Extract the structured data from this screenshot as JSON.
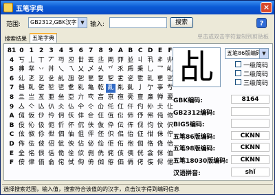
{
  "window": {
    "title": "五笔字典",
    "close_glyph": "×"
  },
  "toolbar": {
    "range_label": "范围:",
    "range_value": "GB2312,GBK汉字",
    "input_label": "输入:",
    "input_value": "",
    "search_label": "搜索",
    "help_label": "?",
    "hint": "单击或双击字符复制到剪贴板"
  },
  "tabs": [
    {
      "label": "搜索结果",
      "active": false
    },
    {
      "label": "五笔字典",
      "active": true
    }
  ],
  "grid": {
    "corner": "81",
    "col_headers": [
      "0",
      "1",
      "2",
      "3",
      "4",
      "5",
      "6",
      "7",
      "8",
      "9",
      "A",
      "B",
      "C",
      "D",
      "E",
      "F"
    ],
    "row_headers": [
      "4",
      "5",
      "6",
      "7",
      "8",
      "9",
      "A",
      "B",
      "C",
      "D",
      "E",
      "F"
    ],
    "rows": [
      [
        "丂",
        "丄",
        "丅",
        "丆",
        "丏",
        "丒",
        "丗",
        "丟",
        "丠",
        "両",
        "丣",
        "並",
        "丩",
        "丮",
        "丯",
        "丱"
      ],
      [
        "丳",
        "丵",
        "丷",
        "丼",
        "乀",
        "乁",
        "乂",
        "乄",
        "乆",
        "乊",
        "乑",
        "乕",
        "乗",
        "乚",
        "乛",
        "乢"
      ],
      [
        "乣",
        "乤",
        "乥",
        "乧",
        "乨",
        "乪",
        "乫",
        "乬",
        "乭",
        "乮",
        "乯",
        "乲",
        "乴",
        "乵",
        "乶",
        "乷"
      ],
      [
        "乸",
        "乹",
        "乺",
        "乻",
        "乼",
        "乽",
        "乿",
        "亀",
        "亁",
        "亂",
        "亃",
        "亄",
        "亅",
        "亇",
        "亊",
        "亐"
      ],
      [
        "亖",
        "亗",
        "亙",
        "亜",
        "亝",
        "亞",
        "亣",
        "亪",
        "亯",
        "亰",
        "亱",
        "亴",
        "亶",
        "亷",
        "亸",
        "亹"
      ],
      [
        "亼",
        "亽",
        "亾",
        "仈",
        "仌",
        "仏",
        "仐",
        "仒",
        "仚",
        "仛",
        "仜",
        "仠",
        "仢",
        "仦",
        "仧",
        "仩"
      ],
      [
        "仭",
        "仮",
        "仯",
        "仱",
        "仴",
        "仸",
        "仹",
        "仺",
        "仼",
        "仾",
        "伀",
        "伂",
        "伃",
        "伄",
        "伅",
        "伆"
      ],
      [
        "伇",
        "伈",
        "伋",
        "伌",
        "伒",
        "伓",
        "伔",
        "伕",
        "伖",
        "伜",
        "伝",
        "伡",
        "伣",
        "伨",
        "伩",
        "伬"
      ],
      [
        "伭",
        "伮",
        "伱",
        "伳",
        "伵",
        "伷",
        "伹",
        "伻",
        "伾",
        "伿",
        "佀",
        "佁",
        "佂",
        "佄",
        "佅",
        "佇"
      ],
      [
        "佈",
        "佉",
        "佊",
        "佋",
        "佌",
        "佒",
        "佔",
        "佖",
        "佡",
        "佢",
        "佦",
        "佨",
        "佪",
        "佫",
        "佭",
        "佮"
      ],
      [
        "佱",
        "佲",
        "佷",
        "佸",
        "佹",
        "佺",
        "佽",
        "侀",
        "侁",
        "侂",
        "侅",
        "侇",
        "侊",
        "侌",
        "侎",
        "侐"
      ],
      [
        "侒",
        "侓",
        "侕",
        "侖",
        "侘",
        "侙",
        "侚",
        "侜",
        "侞",
        "侟",
        "価",
        "侢",
        "侤",
        "侫",
        "侭",
        "侰"
      ]
    ],
    "selected": {
      "row": 3,
      "col": 9
    }
  },
  "detail": {
    "char": "乩",
    "scheme_value": "五笔86版编码",
    "options": [
      "一级简码",
      "二级简码",
      "三级简码"
    ],
    "info": [
      {
        "label": "GBK编码:",
        "value": "8164"
      },
      {
        "label": "GB2312编码:",
        "value": ""
      },
      {
        "label": "BIG5编码:",
        "value": ""
      },
      {
        "label": "五笔86版编码:",
        "value": "CKNN"
      },
      {
        "label": "五笔98版编码:",
        "value": "CKNN"
      },
      {
        "label": "五笔18030版编码:",
        "value": "CKNN"
      },
      {
        "label": "汉语拼音:",
        "value": "shǐ"
      }
    ]
  },
  "status": "选择搜索范围，输入值，搜索符合该值的的汉字，点击汉字得到编码信息"
}
